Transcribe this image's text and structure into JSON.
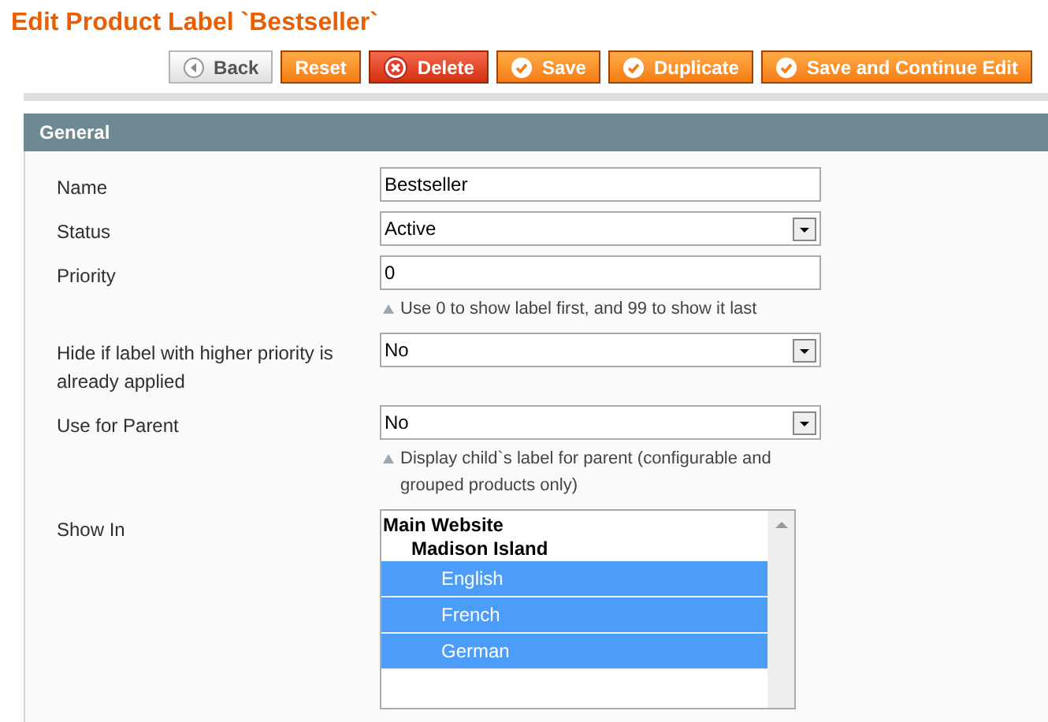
{
  "page_title": "Edit Product Label `Bestseller`",
  "buttons": [
    {
      "label": "Back",
      "kind": "back"
    },
    {
      "label": "Reset",
      "kind": "plain"
    },
    {
      "label": "Delete",
      "kind": "delete"
    },
    {
      "label": "Save",
      "kind": "save"
    },
    {
      "label": "Duplicate",
      "kind": "save"
    },
    {
      "label": "Save and Continue Edit",
      "kind": "save"
    }
  ],
  "section": {
    "title": "General",
    "fields": [
      {
        "label": "Name",
        "kind": "text",
        "value": "Bestseller"
      },
      {
        "label": "Status",
        "kind": "select",
        "value": "Active"
      },
      {
        "label": "Priority",
        "kind": "text",
        "value": "0",
        "hint": "Use 0 to show label first, and 99 to show it last"
      },
      {
        "label": "Hide if label with higher priority is already applied",
        "kind": "select",
        "value": "No"
      },
      {
        "label": "Use for Parent",
        "kind": "select",
        "value": "No",
        "hint": "Display child`s label for parent (configurable and grouped products only)"
      },
      {
        "label": "Show In",
        "kind": "multiselect",
        "options": [
          {
            "label": "Main Website",
            "children": [
              {
                "label": "Madison Island",
                "children": [
                  {
                    "label": "English",
                    "selected": true
                  },
                  {
                    "label": "French",
                    "selected": true
                  },
                  {
                    "label": "German",
                    "selected": true
                  }
                ]
              }
            ]
          }
        ]
      }
    ]
  }
}
